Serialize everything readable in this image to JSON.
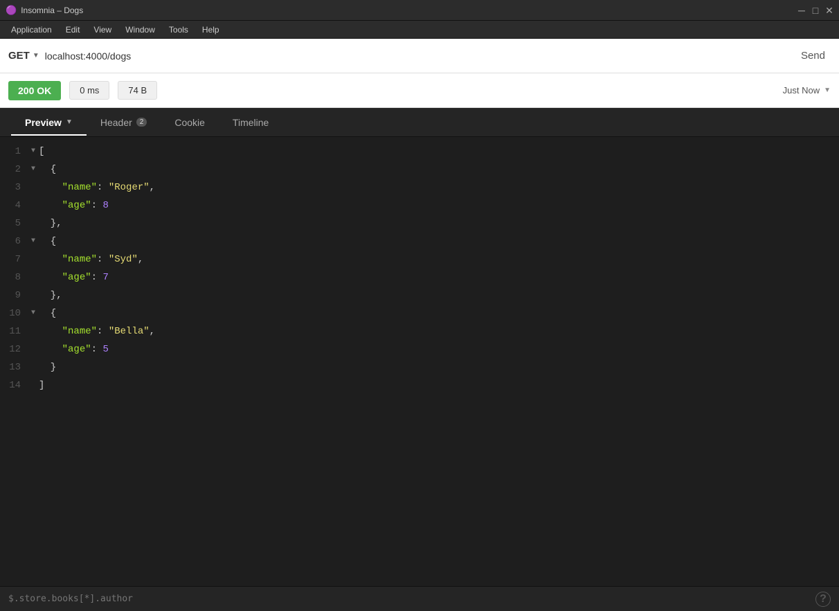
{
  "titleBar": {
    "appName": "Insomnia – Dogs",
    "iconSymbol": "🟣"
  },
  "menuBar": {
    "items": [
      "Application",
      "Edit",
      "View",
      "Window",
      "Tools",
      "Help"
    ]
  },
  "urlBar": {
    "method": "GET",
    "url": "localhost:4000/dogs",
    "sendLabel": "Send"
  },
  "responseBar": {
    "statusCode": "200",
    "statusText": "OK",
    "time": "0 ms",
    "size": "74 B",
    "timestamp": "Just Now"
  },
  "tabs": [
    {
      "id": "preview",
      "label": "Preview",
      "active": true,
      "badge": null,
      "hasChevron": true
    },
    {
      "id": "header",
      "label": "Header",
      "active": false,
      "badge": "2",
      "hasChevron": false
    },
    {
      "id": "cookie",
      "label": "Cookie",
      "active": false,
      "badge": null,
      "hasChevron": false
    },
    {
      "id": "timeline",
      "label": "Timeline",
      "active": false,
      "badge": null,
      "hasChevron": false
    }
  ],
  "codeLines": [
    {
      "num": 1,
      "toggle": "▼",
      "content": "[",
      "type": "bracket"
    },
    {
      "num": 2,
      "toggle": "▼",
      "content": "  {",
      "type": "bracket"
    },
    {
      "num": 3,
      "toggle": null,
      "content": "    \"name\": \"Roger\",",
      "type": "keystring"
    },
    {
      "num": 4,
      "toggle": null,
      "content": "    \"age\": 8",
      "type": "keynumber"
    },
    {
      "num": 5,
      "toggle": null,
      "content": "  },",
      "type": "bracket"
    },
    {
      "num": 6,
      "toggle": "▼",
      "content": "  {",
      "type": "bracket"
    },
    {
      "num": 7,
      "toggle": null,
      "content": "    \"name\": \"Syd\",",
      "type": "keystring"
    },
    {
      "num": 8,
      "toggle": null,
      "content": "    \"age\": 7",
      "type": "keynumber"
    },
    {
      "num": 9,
      "toggle": null,
      "content": "  },",
      "type": "bracket"
    },
    {
      "num": 10,
      "toggle": "▼",
      "content": "  {",
      "type": "bracket"
    },
    {
      "num": 11,
      "toggle": null,
      "content": "    \"name\": \"Bella\",",
      "type": "keystring"
    },
    {
      "num": 12,
      "toggle": null,
      "content": "    \"age\": 5",
      "type": "keynumber"
    },
    {
      "num": 13,
      "toggle": null,
      "content": "  }",
      "type": "bracket"
    },
    {
      "num": 14,
      "toggle": null,
      "content": "]",
      "type": "bracket"
    }
  ],
  "bottomBar": {
    "filterPlaceholder": "$.store.books[*].author",
    "helpLabel": "?"
  }
}
